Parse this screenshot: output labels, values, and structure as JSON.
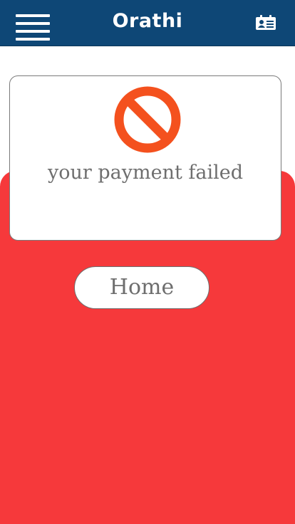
{
  "header": {
    "title": "Orathi",
    "menu_icon": "hamburger-menu-icon",
    "card_icon": "id-card-icon"
  },
  "status": {
    "icon": "prohibited-icon",
    "message": "your payment failed"
  },
  "actions": {
    "home_label": "Home"
  },
  "colors": {
    "header": "#0e4776",
    "panel": "#f6393b",
    "fail_icon": "#f4511e",
    "text": "#6e6e6e"
  }
}
